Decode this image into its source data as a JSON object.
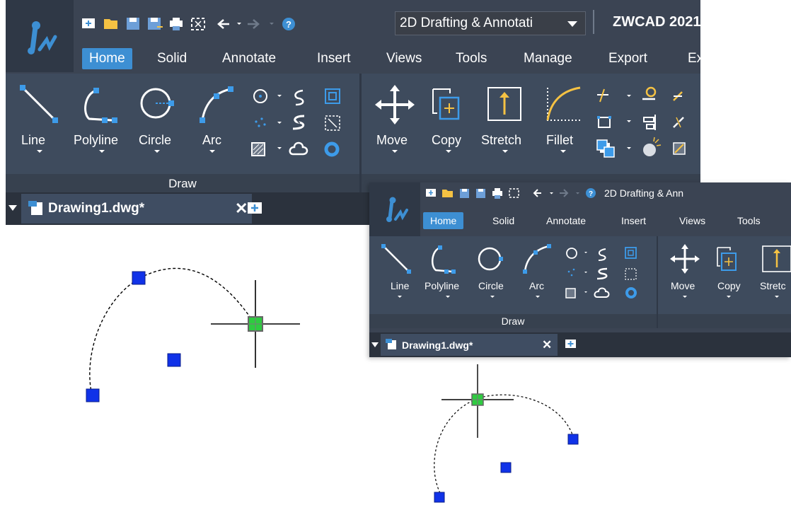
{
  "app": {
    "name": "ZWCAD 2021",
    "workspace": "2D Drafting & Annotati",
    "workspace_small": "2D Drafting & Ann"
  },
  "tabs": [
    "Home",
    "Solid",
    "Annotate",
    "Insert",
    "Views",
    "Tools",
    "Manage",
    "Export",
    "Ex"
  ],
  "tabs_small": [
    "Home",
    "Solid",
    "Annotate",
    "Insert",
    "Views",
    "Tools"
  ],
  "draw": {
    "title": "Draw",
    "line": "Line",
    "polyline": "Polyline",
    "circle": "Circle",
    "arc": "Arc"
  },
  "modify": {
    "move": "Move",
    "copy": "Copy",
    "stretch": "Stretch",
    "fillet": "Fillet",
    "stretch_small": "Stretc"
  },
  "document": {
    "tab": "Drawing1.dwg*",
    "close": "✕"
  },
  "colors": {
    "accent": "#3d8fd3",
    "ribbon": "#3e4b5d",
    "grip": "#1032e8",
    "grip_hot": "#2ecc40"
  }
}
